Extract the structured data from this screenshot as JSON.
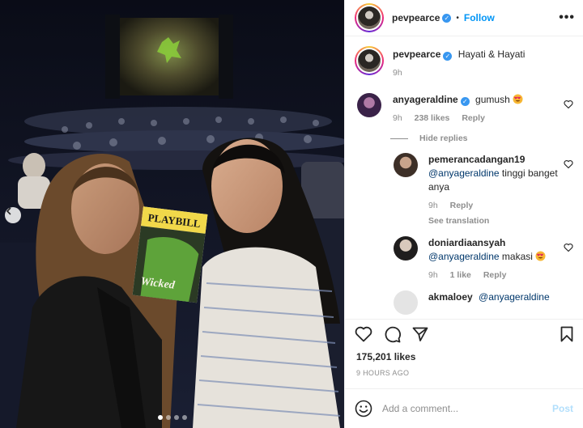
{
  "post": {
    "author": "pevpearce",
    "follow_label": "Follow",
    "bullet": "•",
    "more_label": "•••",
    "caption": "Hayati & Hayati",
    "caption_time": "9h",
    "likes": "175,201 likes",
    "posted_ago": "9 HOURS AGO",
    "carousel_count": 4,
    "carousel_active": 0
  },
  "comments": [
    {
      "user": "anyageraldine",
      "verified": true,
      "text": "gumush",
      "emoji": "heart-eyes",
      "time": "9h",
      "likes": "238 likes",
      "reply": "Reply"
    }
  ],
  "hide_replies": "Hide replies",
  "replies": [
    {
      "user": "pemerancadangan19",
      "mention": "@anyageraldine",
      "text": "tinggi banget anya",
      "time": "9h",
      "reply": "Reply",
      "see_translation": "See translation"
    },
    {
      "user": "doniardiaansyah",
      "mention": "@anyageraldine",
      "text": "makasi",
      "emoji": "heart-eyes",
      "time": "9h",
      "likes": "1 like",
      "reply": "Reply"
    },
    {
      "user": "akmaloey",
      "mention": "@anyageraldine"
    }
  ],
  "composer": {
    "placeholder": "Add a comment...",
    "post_label": "Post"
  },
  "photo": {
    "playbill_title": "PLAYBILL",
    "show_name": "Wicked"
  },
  "colors": {
    "link": "#0095f6",
    "verified": "#3897f0",
    "muted": "#8e8e8e",
    "mention": "#00376b"
  }
}
